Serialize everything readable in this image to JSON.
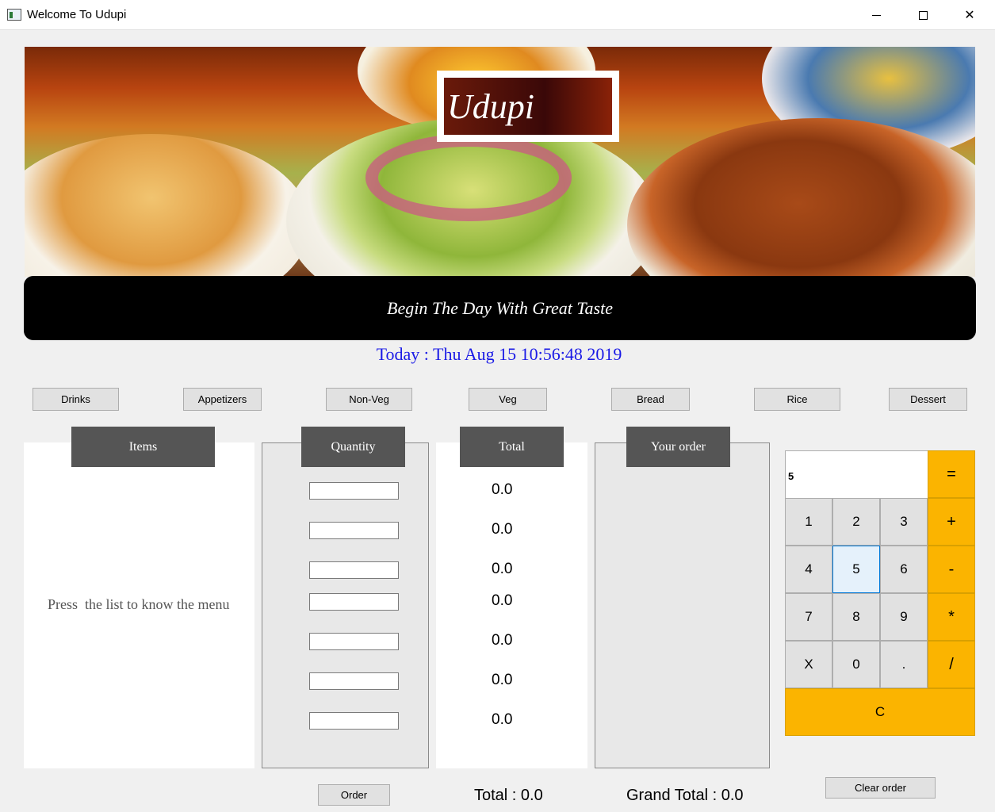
{
  "window": {
    "title": "Welcome To Udupi",
    "minimize": "",
    "maximize": "",
    "close": "✕"
  },
  "banner": {
    "logo": "Udupi",
    "tagline": "Begin The Day With Great Taste"
  },
  "date": "Today : Thu Aug 15 10:56:48 2019",
  "categories": [
    "Drinks",
    "Appetizers",
    "Non-Veg",
    "Veg",
    "Bread",
    "Rice",
    "Dessert"
  ],
  "headers": {
    "items": "Items",
    "quantity": "Quantity",
    "total": "Total",
    "your_order": "Your order"
  },
  "items_hint": "Press  the list to know the menu",
  "quantities": [
    "",
    "",
    "",
    "",
    "",
    "",
    ""
  ],
  "totals": [
    "0.0",
    "0.0",
    "0.0",
    "0.0",
    "0.0",
    "0.0",
    "0.0"
  ],
  "calculator": {
    "display": "5",
    "keys": [
      "1",
      "2",
      "3",
      "4",
      "5",
      "6",
      "7",
      "8",
      "9",
      "X",
      "0",
      "."
    ],
    "ops": [
      "=",
      "+",
      "-",
      "*",
      "/"
    ],
    "clear": "C"
  },
  "buttons": {
    "order": "Order",
    "clear_order": "Clear order"
  },
  "summary": {
    "total": "Total : 0.0",
    "grand_total": "Grand Total : 0.0"
  },
  "colors": {
    "accent": "#fbb400",
    "date": "#1a1ae6",
    "header": "#555555"
  }
}
